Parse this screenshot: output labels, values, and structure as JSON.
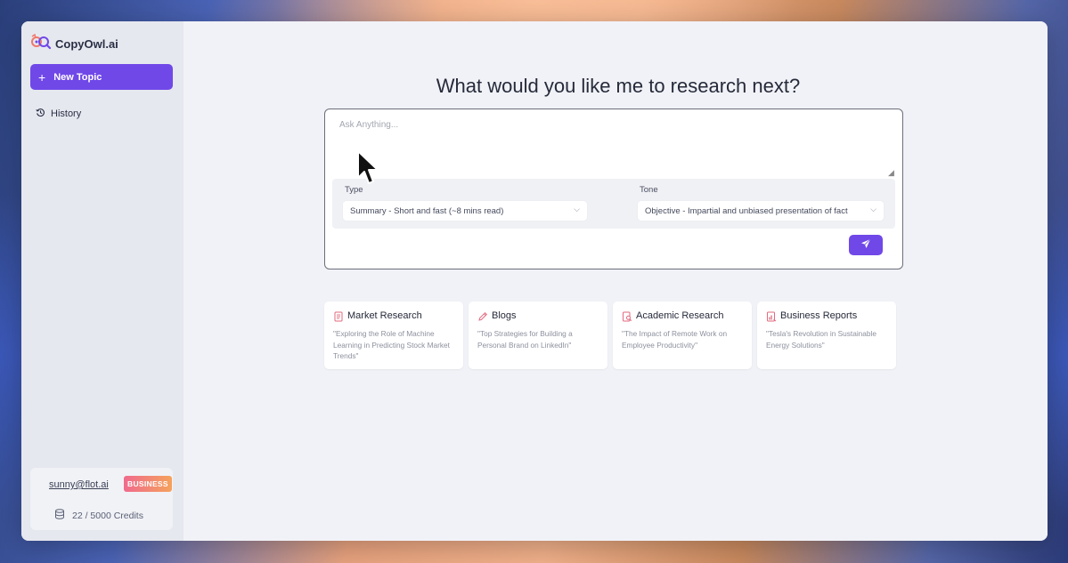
{
  "app": {
    "name": "CopyOwl.ai"
  },
  "sidebar": {
    "new_topic_label": "New Topic",
    "history_label": "History",
    "account": {
      "email": "sunny@flot.ai",
      "plan_badge": "BUSINESS",
      "credits": "22 / 5000 Credits"
    }
  },
  "main": {
    "heading": "What would you like me to research next?",
    "search": {
      "placeholder": "Ask Anything...",
      "value": ""
    },
    "type": {
      "label": "Type",
      "selected": "Summary - Short and fast (~8 mins read)"
    },
    "tone": {
      "label": "Tone",
      "selected": "Objective - Impartial and unbiased presentation of fact"
    },
    "cards": [
      {
        "title": "Market Research",
        "desc": "\"Exploring the Role of Machine Learning in Predicting Stock Market Trends\""
      },
      {
        "title": "Blogs",
        "desc": "\"Top Strategies for Building a Personal Brand on LinkedIn\""
      },
      {
        "title": "Academic Research",
        "desc": "\"The Impact of Remote Work on Employee Productivity\""
      },
      {
        "title": "Business Reports",
        "desc": "\"Tesla's Revolution in Sustainable Energy Solutions\""
      }
    ]
  },
  "colors": {
    "accent": "#7048e8",
    "badge_from": "#f06a8d",
    "badge_to": "#f5a25c"
  },
  "icons": [
    "owl-logo-icon",
    "plus-icon",
    "history-icon",
    "database-icon",
    "chevron-down-icon",
    "send-icon",
    "document-icon",
    "pencil-icon",
    "search-document-icon",
    "chart-icon",
    "mouse-cursor-icon"
  ]
}
